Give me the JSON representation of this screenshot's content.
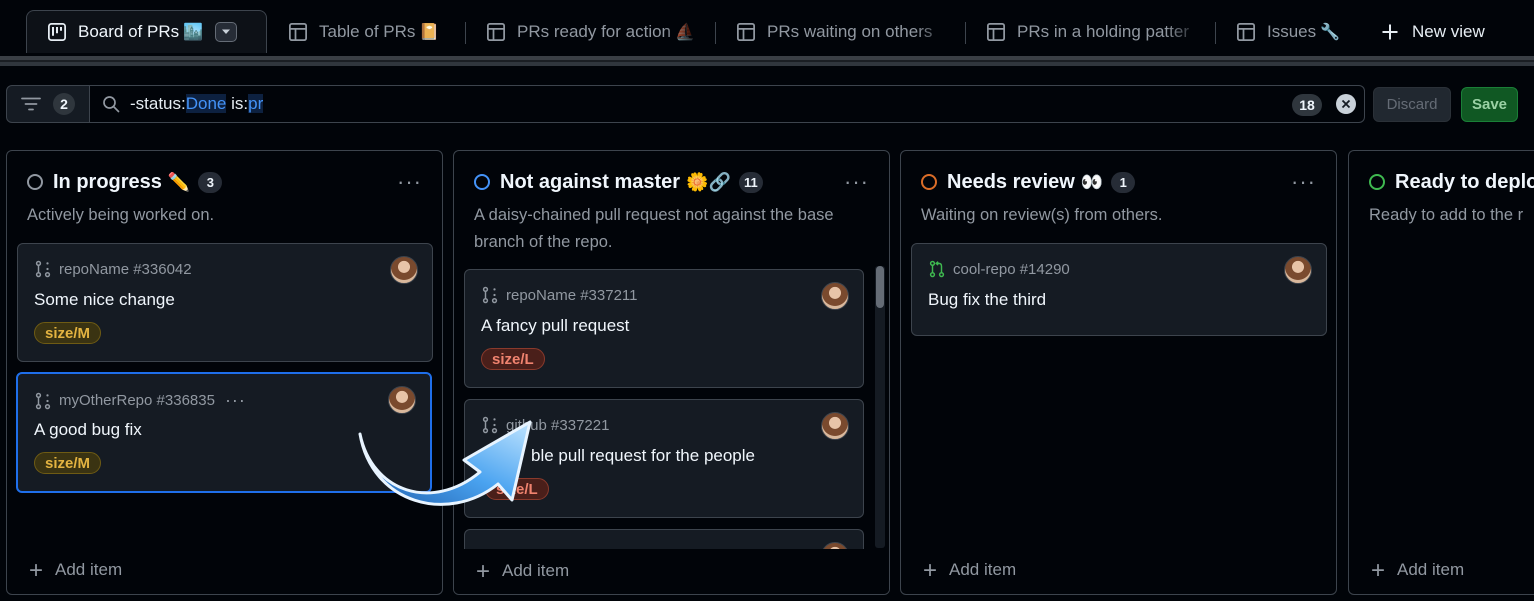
{
  "tabs": [
    {
      "label": "Board of PRs",
      "emoji": "🏙️",
      "active": true,
      "icon": "project-board-icon"
    },
    {
      "label": "Table of PRs",
      "emoji": "📔",
      "icon": "table-icon"
    },
    {
      "label": "PRs ready for action",
      "emoji": "⛵",
      "icon": "table-icon"
    },
    {
      "label": "PRs waiting on others",
      "emoji": "",
      "icon": "table-icon"
    },
    {
      "label": "PRs in a holding patter",
      "emoji": "",
      "icon": "table-icon"
    },
    {
      "label": "Issues",
      "emoji": "🔧",
      "icon": "table-icon"
    }
  ],
  "new_view_label": "New view",
  "filter": {
    "count": "2",
    "query_parts": [
      "-status:",
      "Done",
      " is:",
      "pr"
    ],
    "result_count": "18"
  },
  "buttons": {
    "discard": "Discard",
    "save": "Save"
  },
  "columns": [
    {
      "title": "In progress",
      "emoji": "✏️",
      "count": "3",
      "description": "Actively being worked on.",
      "status_color": "#9198a1",
      "cards": [
        {
          "repo": "repoName #336042",
          "title": "Some nice change",
          "label": "size/M"
        },
        {
          "repo": "myOtherRepo #336835",
          "title": "A good bug fix",
          "label": "size/M"
        }
      ],
      "add_item": "Add item"
    },
    {
      "title": "Not against master",
      "emoji": "🌼🔗",
      "count": "11",
      "description": "A daisy-chained pull request not against the base branch of the repo.",
      "status_color": "#4493f8",
      "cards": [
        {
          "repo": "repoName #337211",
          "title": "A fancy pull request",
          "label": "size/L"
        },
        {
          "repo": "github #337221",
          "title": "ble pull request for the people",
          "label": "size/L"
        }
      ],
      "add_item": "Add item"
    },
    {
      "title": "Needs review",
      "emoji": "👀",
      "count": "1",
      "description": "Waiting on review(s) from others.",
      "status_color": "#db6d28",
      "cards": [
        {
          "repo": "cool-repo #14290",
          "title": "Bug fix the third"
        }
      ],
      "add_item": "Add item"
    },
    {
      "title": "Ready to deplo",
      "emoji": "",
      "description": "Ready to add to the r",
      "status_color": "#3fb950",
      "add_item": "Add item"
    }
  ],
  "icons": {
    "pr_draft": "git-pull-request-draft-icon",
    "pr_open": "git-pull-request-icon",
    "drag_arrow": "drag-arrow-illustration"
  }
}
